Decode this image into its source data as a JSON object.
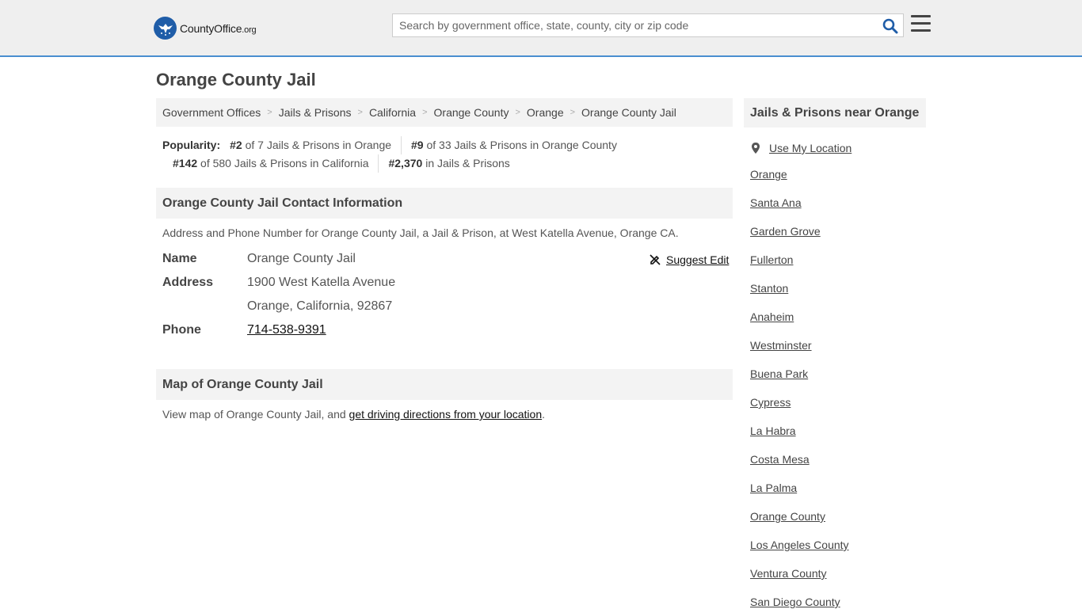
{
  "header": {
    "logo": {
      "name": "County",
      "name_bold": "Office",
      "tld": ".org"
    },
    "search": {
      "placeholder": "Search by government office, state, county, city or zip code"
    }
  },
  "page": {
    "title": "Orange County Jail"
  },
  "breadcrumb": [
    "Government Offices",
    "Jails & Prisons",
    "California",
    "Orange County",
    "Orange",
    "Orange County Jail"
  ],
  "popularity": {
    "label": "Popularity:",
    "items": [
      {
        "rank": "#2",
        "text": "of 7 Jails & Prisons in Orange"
      },
      {
        "rank": "#9",
        "text": "of 33 Jails & Prisons in Orange County"
      },
      {
        "rank": "#142",
        "text": "of 580 Jails & Prisons in California"
      },
      {
        "rank": "#2,370",
        "text": "in Jails & Prisons"
      }
    ]
  },
  "contact": {
    "heading": "Orange County Jail Contact Information",
    "description": "Address and Phone Number for Orange County Jail, a Jail & Prison, at West Katella Avenue, Orange CA.",
    "suggest_edit": "Suggest Edit",
    "name_label": "Name",
    "name_value": "Orange County Jail",
    "address_label": "Address",
    "address_line1": "1900 West Katella Avenue",
    "address_line2": "Orange, California, 92867",
    "phone_label": "Phone",
    "phone_value": "714-538-9391"
  },
  "map": {
    "heading": "Map of Orange County Jail",
    "description_prefix": "View map of Orange County Jail, and ",
    "directions_link": "get driving directions from your location",
    "description_suffix": "."
  },
  "sidebar": {
    "heading": "Jails & Prisons near Orange",
    "use_location": "Use My Location",
    "links": [
      "Orange",
      "Santa Ana",
      "Garden Grove",
      "Fullerton",
      "Stanton",
      "Anaheim",
      "Westminster",
      "Buena Park",
      "Cypress",
      "La Habra",
      "Costa Mesa",
      "La Palma",
      "Orange County",
      "Los Angeles County",
      "Ventura County",
      "San Diego County"
    ]
  },
  "colors": {
    "accent": "#4a8ed0",
    "logo_blue": "#1f5da8",
    "search_icon": "#1f5da8",
    "panel_bg": "#f3f3f3",
    "topbar_bg": "#efefef"
  }
}
